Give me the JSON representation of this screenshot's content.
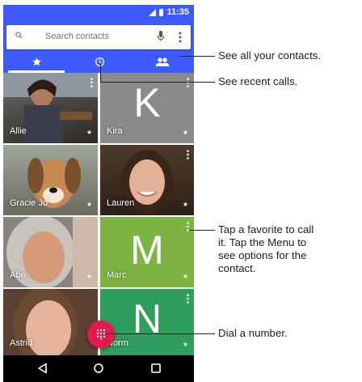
{
  "statusbar": {
    "time": "11:35"
  },
  "search": {
    "placeholder": "Search contacts"
  },
  "tabs": [
    {
      "icon": "star-icon"
    },
    {
      "icon": "clock-icon"
    },
    {
      "icon": "people-icon"
    }
  ],
  "favorites": [
    {
      "name": "Allie",
      "style": "photo",
      "initial": ""
    },
    {
      "name": "Kira",
      "style": "letter",
      "initial": "K",
      "color": "#8a8a8a"
    },
    {
      "name": "Gracie Jo",
      "style": "photo",
      "initial": ""
    },
    {
      "name": "Lauren",
      "style": "photo",
      "initial": ""
    },
    {
      "name": "Abe",
      "style": "photo",
      "initial": ""
    },
    {
      "name": "Marc",
      "style": "letter",
      "initial": "M",
      "color": "#7cb342"
    },
    {
      "name": "Astrid",
      "style": "photo",
      "initial": ""
    },
    {
      "name": "Norm",
      "style": "letter",
      "initial": "N",
      "color": "#2e9e5c"
    }
  ],
  "colors": {
    "accent": "#3d5afe",
    "fab": "#e5194b"
  },
  "callouts": {
    "contacts": "See all your contacts.",
    "recent": "See recent calls.",
    "favorite": "Tap a favorite to call it. Tap the Menu to see options for the contact.",
    "favorite_lines": [
      "Tap a favorite to call",
      "it. Tap the Menu to",
      "see options for the",
      "contact."
    ],
    "dial": "Dial a number."
  }
}
